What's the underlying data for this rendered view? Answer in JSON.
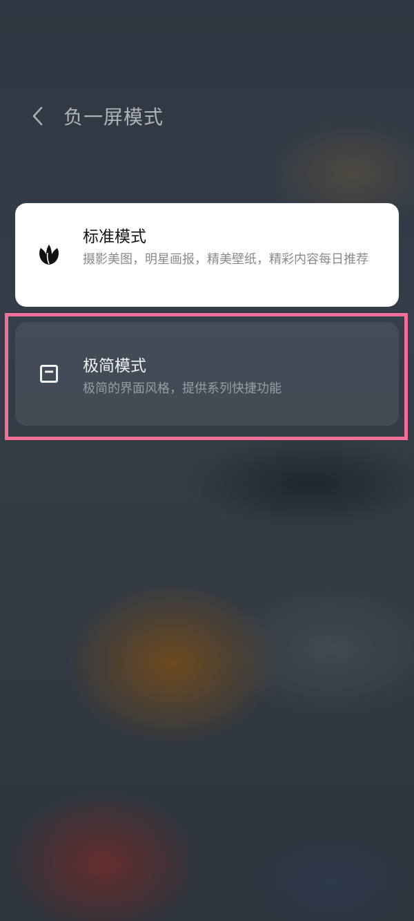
{
  "header": {
    "title": "负一屏模式"
  },
  "modes": [
    {
      "title": "标准模式",
      "description": "摄影美图，明星画报，精美壁纸，精彩内容每日推荐",
      "icon": "leaf-icon"
    },
    {
      "title": "极简模式",
      "description": "极简的界面风格，提供系列快捷功能",
      "icon": "minimal-card-icon"
    }
  ],
  "colors": {
    "highlight": "#f0709a",
    "standard_card_bg": "#ffffff"
  }
}
